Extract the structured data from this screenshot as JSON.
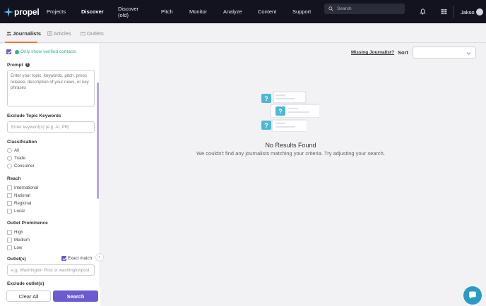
{
  "app": {
    "logo_text": "propel",
    "brand_color": "#12131f",
    "accent": "#6b5bd0",
    "tab_underline": "#f0763a"
  },
  "nav": {
    "items": [
      {
        "label": "Projects",
        "active": false
      },
      {
        "label": "Discover",
        "active": true
      },
      {
        "label": "Discover (old)",
        "active": false
      },
      {
        "label": "Pitch",
        "active": false
      },
      {
        "label": "Monitor",
        "active": false
      },
      {
        "label": "Analyze",
        "active": false
      },
      {
        "label": "Content",
        "active": false
      },
      {
        "label": "Support",
        "active": false
      }
    ],
    "search_placeholder": "Search",
    "user_name": "Jakso",
    "icons": [
      "bell-icon",
      "grid-icon",
      "avatar-icon"
    ]
  },
  "tabs": [
    {
      "label": "Journalists",
      "active": true,
      "icon": "people-icon"
    },
    {
      "label": "Articles",
      "active": false,
      "icon": "article-icon"
    },
    {
      "label": "Outlets",
      "active": false,
      "icon": "outlet-icon"
    }
  ],
  "sidebar": {
    "verified_label": "Only show verified contacts",
    "verified_checked": true,
    "prompt_label": "Prompt",
    "prompt_placeholder": "Enter your topic, keywords, pitch, press release, description of your news, or key phrases",
    "exclude_label": "Exclude Topic Keywords",
    "exclude_placeholder": "Enter keyword(s) (e.g. AI, PR)",
    "classification": {
      "label": "Classification",
      "options": [
        "All",
        "Trade",
        "Consumer"
      ]
    },
    "reach": {
      "label": "Reach",
      "options": [
        "International",
        "National",
        "Regional",
        "Local"
      ]
    },
    "prominence": {
      "label": "Outlet Prominence",
      "options": [
        "High",
        "Medium",
        "Low"
      ]
    },
    "outlets_label": "Outlet(s)",
    "exact_match_label": "Exact match",
    "exact_match_checked": true,
    "outlets_placeholder": "e.g. Washington Post or washingtonpost.com",
    "exclude_outlets_label": "Exclude outlet(s)",
    "clear_label": "Clear All",
    "search_label": "Search"
  },
  "main": {
    "missing_link": "Missing Journalist?",
    "sort_label": "Sort",
    "sort_value": "",
    "no_results_title": "No Results Found",
    "no_results_sub": "We couldn't find any journalists matching your criteria. Try adjusting your search."
  }
}
